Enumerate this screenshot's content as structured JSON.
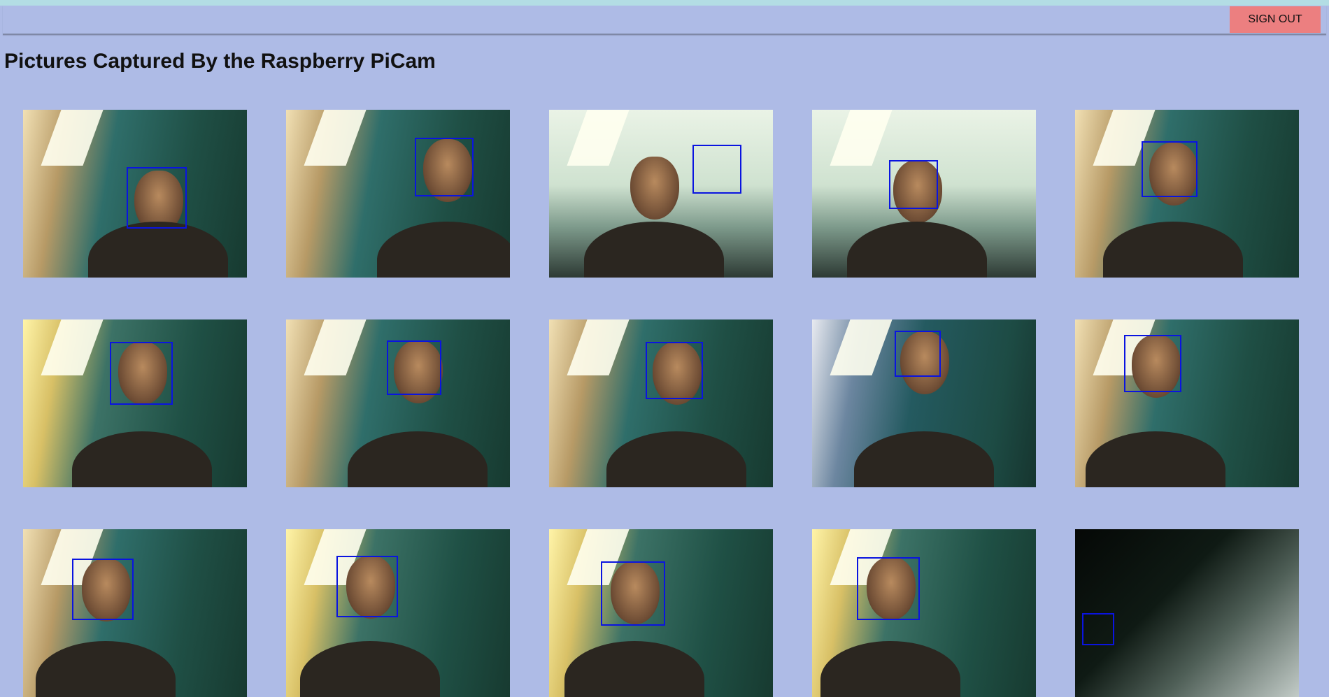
{
  "header": {
    "signout_label": "SIGN OUT"
  },
  "page": {
    "title": "Pictures Captured By the Raspberry PiCam"
  },
  "colors": {
    "background": "#aebbe6",
    "signout": "#ec7f80",
    "facebox": "#0a14e0"
  },
  "photos": [
    {
      "theme": "warm",
      "label": "camera-photo-1"
    },
    {
      "theme": "warm",
      "label": "camera-photo-2"
    },
    {
      "theme": "bright",
      "label": "camera-photo-3"
    },
    {
      "theme": "bright",
      "label": "camera-photo-4"
    },
    {
      "theme": "warm",
      "label": "camera-photo-5"
    },
    {
      "theme": "yellow",
      "label": "camera-photo-6"
    },
    {
      "theme": "warm",
      "label": "camera-photo-7"
    },
    {
      "theme": "warm",
      "label": "camera-photo-8"
    },
    {
      "theme": "blur",
      "label": "camera-photo-9"
    },
    {
      "theme": "warm",
      "label": "camera-photo-10"
    },
    {
      "theme": "warm",
      "label": "camera-photo-11"
    },
    {
      "theme": "yellow",
      "label": "camera-photo-12"
    },
    {
      "theme": "yellow",
      "label": "camera-photo-13"
    },
    {
      "theme": "yellow",
      "label": "camera-photo-14"
    },
    {
      "theme": "dark",
      "label": "camera-photo-15"
    }
  ]
}
